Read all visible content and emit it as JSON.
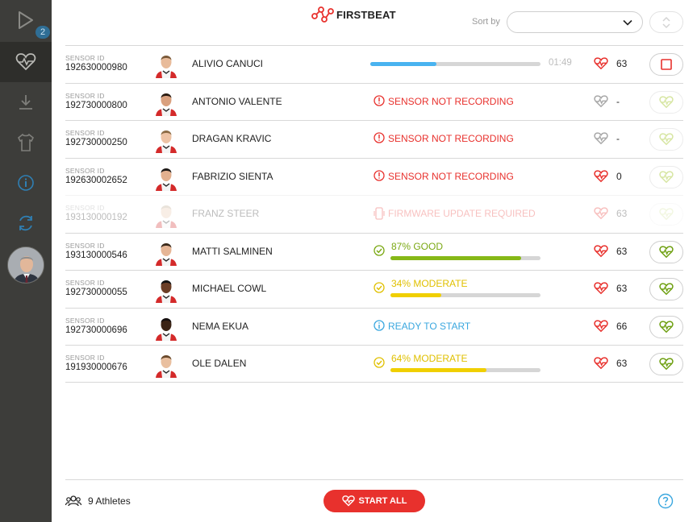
{
  "sidebar": {
    "items": [
      {
        "icon": "play-icon",
        "badge": "2"
      },
      {
        "icon": "heart-pulse-icon",
        "active": true
      },
      {
        "icon": "download-icon"
      },
      {
        "icon": "shirt-icon"
      },
      {
        "icon": "info-icon"
      },
      {
        "icon": "sync-icon"
      }
    ]
  },
  "header": {
    "logo": "FIRSTBEAT",
    "sort_label": "Sort by",
    "sort_value": ""
  },
  "sensor_id_label": "SENSOR ID",
  "athletes": [
    {
      "sensor_id": "192630000980",
      "name": "ALIVIO CANUCI",
      "status": "recording",
      "progress": 0.39,
      "timer": "01:49",
      "hr": "63",
      "heart": "red",
      "action": "stop"
    },
    {
      "sensor_id": "192730000800",
      "name": "ANTONIO VALENTE",
      "status": "error",
      "status_text": "SENSOR NOT RECORDING",
      "hr": "-",
      "heart": "gray",
      "action": "faint"
    },
    {
      "sensor_id": "192730000250",
      "name": "DRAGAN KRAVIC",
      "status": "error",
      "status_text": "SENSOR NOT RECORDING",
      "hr": "-",
      "heart": "gray",
      "action": "faint"
    },
    {
      "sensor_id": "192630002652",
      "name": "FABRIZIO SIENTA",
      "status": "error",
      "status_text": "SENSOR NOT RECORDING",
      "hr": "0",
      "heart": "red",
      "action": "faint"
    },
    {
      "sensor_id": "193130000192",
      "name": "FRANZ STEER",
      "status": "firmware",
      "status_text": "FIRMWARE UPDATE REQUIRED",
      "hr": "63",
      "heart": "red",
      "action": "faint",
      "disabled": true
    },
    {
      "sensor_id": "193130000546",
      "name": "MATTI SALMINEN",
      "status": "good",
      "status_text": "87% GOOD",
      "quality": 0.87,
      "hr": "63",
      "heart": "red",
      "action": "start"
    },
    {
      "sensor_id": "192730000055",
      "name": "MICHAEL COWL",
      "status": "moderate",
      "status_text": "34% MODERATE",
      "quality": 0.34,
      "hr": "63",
      "heart": "red",
      "action": "start"
    },
    {
      "sensor_id": "192730000696",
      "name": "NEMA EKUA",
      "status": "ready",
      "status_text": "READY TO START",
      "hr": "66",
      "heart": "red",
      "action": "start"
    },
    {
      "sensor_id": "191930000676",
      "name": "OLE DALEN",
      "status": "moderate",
      "status_text": "64% MODERATE",
      "quality": 0.64,
      "hr": "63",
      "heart": "red",
      "action": "start"
    }
  ],
  "footer": {
    "athletes_count": "9 Athletes",
    "start_all": "START ALL"
  },
  "colors": {
    "accent_red": "#e8312d",
    "good_green": "#86b817",
    "moderate_yellow": "#f0cf00",
    "ready_blue": "#3aa7df",
    "progress_blue": "#49b3f0",
    "sidebar": "#3d3d3a"
  }
}
